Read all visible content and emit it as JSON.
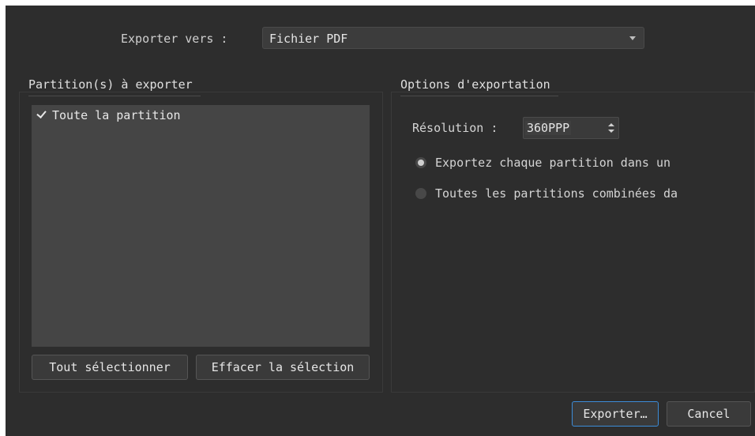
{
  "export": {
    "label": "Exporter vers :",
    "format": "Fichier PDF"
  },
  "scores_group": {
    "title": "Partition(s) à exporter",
    "items": [
      {
        "label": "Toute la partition",
        "checked": true
      }
    ],
    "select_all_label": "Tout sélectionner",
    "clear_selection_label": "Effacer la sélection"
  },
  "options_group": {
    "title": "Options d'exportation",
    "resolution_label": "Résolution :",
    "resolution_value": "360PPP",
    "radio_options": [
      {
        "label": "Exportez chaque partition dans un",
        "selected": true
      },
      {
        "label": "Toutes les partitions combinées da",
        "selected": false
      }
    ]
  },
  "footer": {
    "export_button": "Exporter…",
    "cancel_button": "Cancel"
  }
}
